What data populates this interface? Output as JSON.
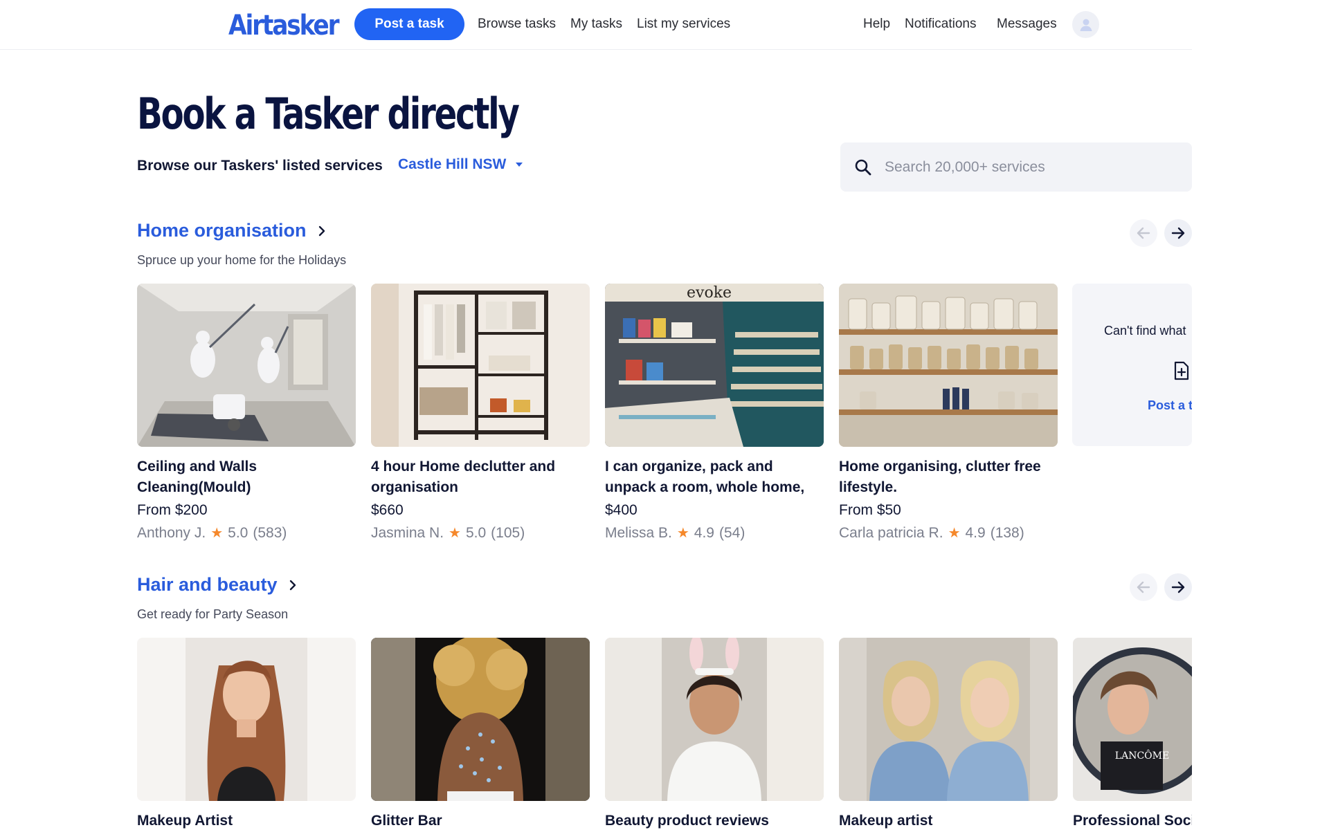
{
  "nav": {
    "logo": "Airtasker",
    "post_task": "Post a task",
    "links": [
      "Browse tasks",
      "My tasks",
      "List my services"
    ],
    "right_links": [
      "Help",
      "Notifications",
      "Messages"
    ],
    "avatar_icon": "user-icon"
  },
  "hero": {
    "title": "Book a Tasker directly",
    "subtitle": "Browse our Taskers' listed services",
    "location": "Castle Hill NSW",
    "search_placeholder": "Search 20,000+ services"
  },
  "sections": [
    {
      "title": "Home organisation",
      "subtitle": "Spruce up your home for the Holidays",
      "cards": [
        {
          "title": "Ceiling and Walls Cleaning(Mould)",
          "price": "From $200",
          "tasker": "Anthony J.",
          "rating": "5.0",
          "reviews": "(583)"
        },
        {
          "title": "4 hour Home declutter and organisation",
          "price": "$660",
          "tasker": "Jasmina N.",
          "rating": "5.0",
          "reviews": "(105)"
        },
        {
          "title": "I can organize, pack and unpack a room, whole home, office or...",
          "price": "$400",
          "tasker": "Melissa B.",
          "rating": "4.9",
          "reviews": "(54)"
        },
        {
          "title": "Home organising, clutter free lifestyle.",
          "price": "From $50",
          "tasker": "Carla patricia R.",
          "rating": "4.9",
          "reviews": "(138)"
        }
      ],
      "cta": {
        "text": "Can't find what",
        "link": "Post a t"
      }
    },
    {
      "title": "Hair and beauty",
      "subtitle": "Get ready for Party Season",
      "cards": [
        {
          "title": "Makeup Artist"
        },
        {
          "title": "Glitter Bar"
        },
        {
          "title": "Beauty product reviews"
        },
        {
          "title": "Makeup artist"
        },
        {
          "title": "Professional Soci"
        }
      ]
    }
  ],
  "image_text": {
    "shop_sign": "evoke",
    "mirror_brand": "LANCÔME"
  },
  "colors": {
    "brand": "#2a5cdc",
    "button": "#2164f3",
    "heading": "#0a1440",
    "star": "#f5882b"
  }
}
